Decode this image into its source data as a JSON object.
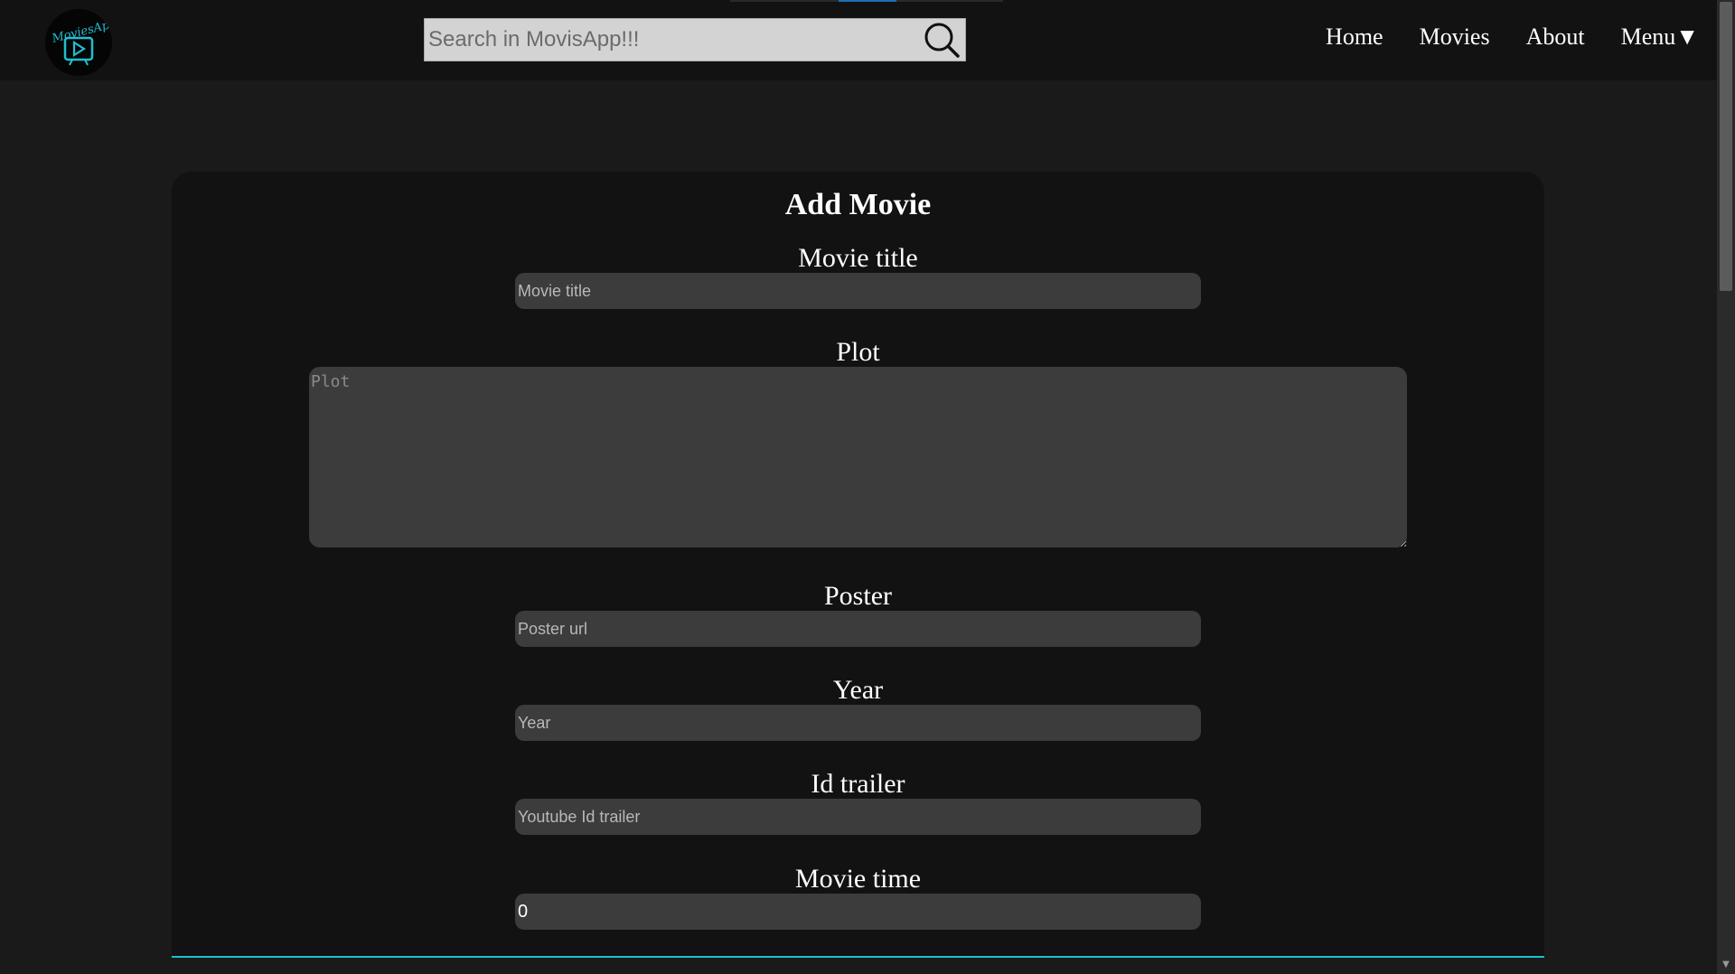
{
  "app": {
    "logo_text": "MoviesApp"
  },
  "search": {
    "placeholder": "Search in MovisApp!!!"
  },
  "nav": {
    "items": [
      {
        "label": "Home"
      },
      {
        "label": "Movies"
      },
      {
        "label": "About"
      },
      {
        "label": "Menu▼"
      }
    ]
  },
  "form": {
    "title": "Add Movie",
    "fields": [
      {
        "label": "Movie title",
        "placeholder": "Movie title",
        "value": ""
      },
      {
        "label": "Plot",
        "placeholder": "Plot",
        "value": ""
      },
      {
        "label": "Poster",
        "placeholder": "Poster url",
        "value": ""
      },
      {
        "label": "Year",
        "placeholder": "Year",
        "value": ""
      },
      {
        "label": "Id trailer",
        "placeholder": "Youtube Id trailer",
        "value": ""
      },
      {
        "label": "Movie time",
        "placeholder": "",
        "value": "0"
      }
    ]
  },
  "colors": {
    "accent": "#1fbfd0",
    "navbar_bg": "#121212",
    "page_bg": "#1a1a1a",
    "input_bg": "#3c3c3c"
  },
  "icons": {
    "search": "magnifier-icon",
    "logo": "play-button-icon",
    "scroll_down": "chevron-down-icon"
  }
}
